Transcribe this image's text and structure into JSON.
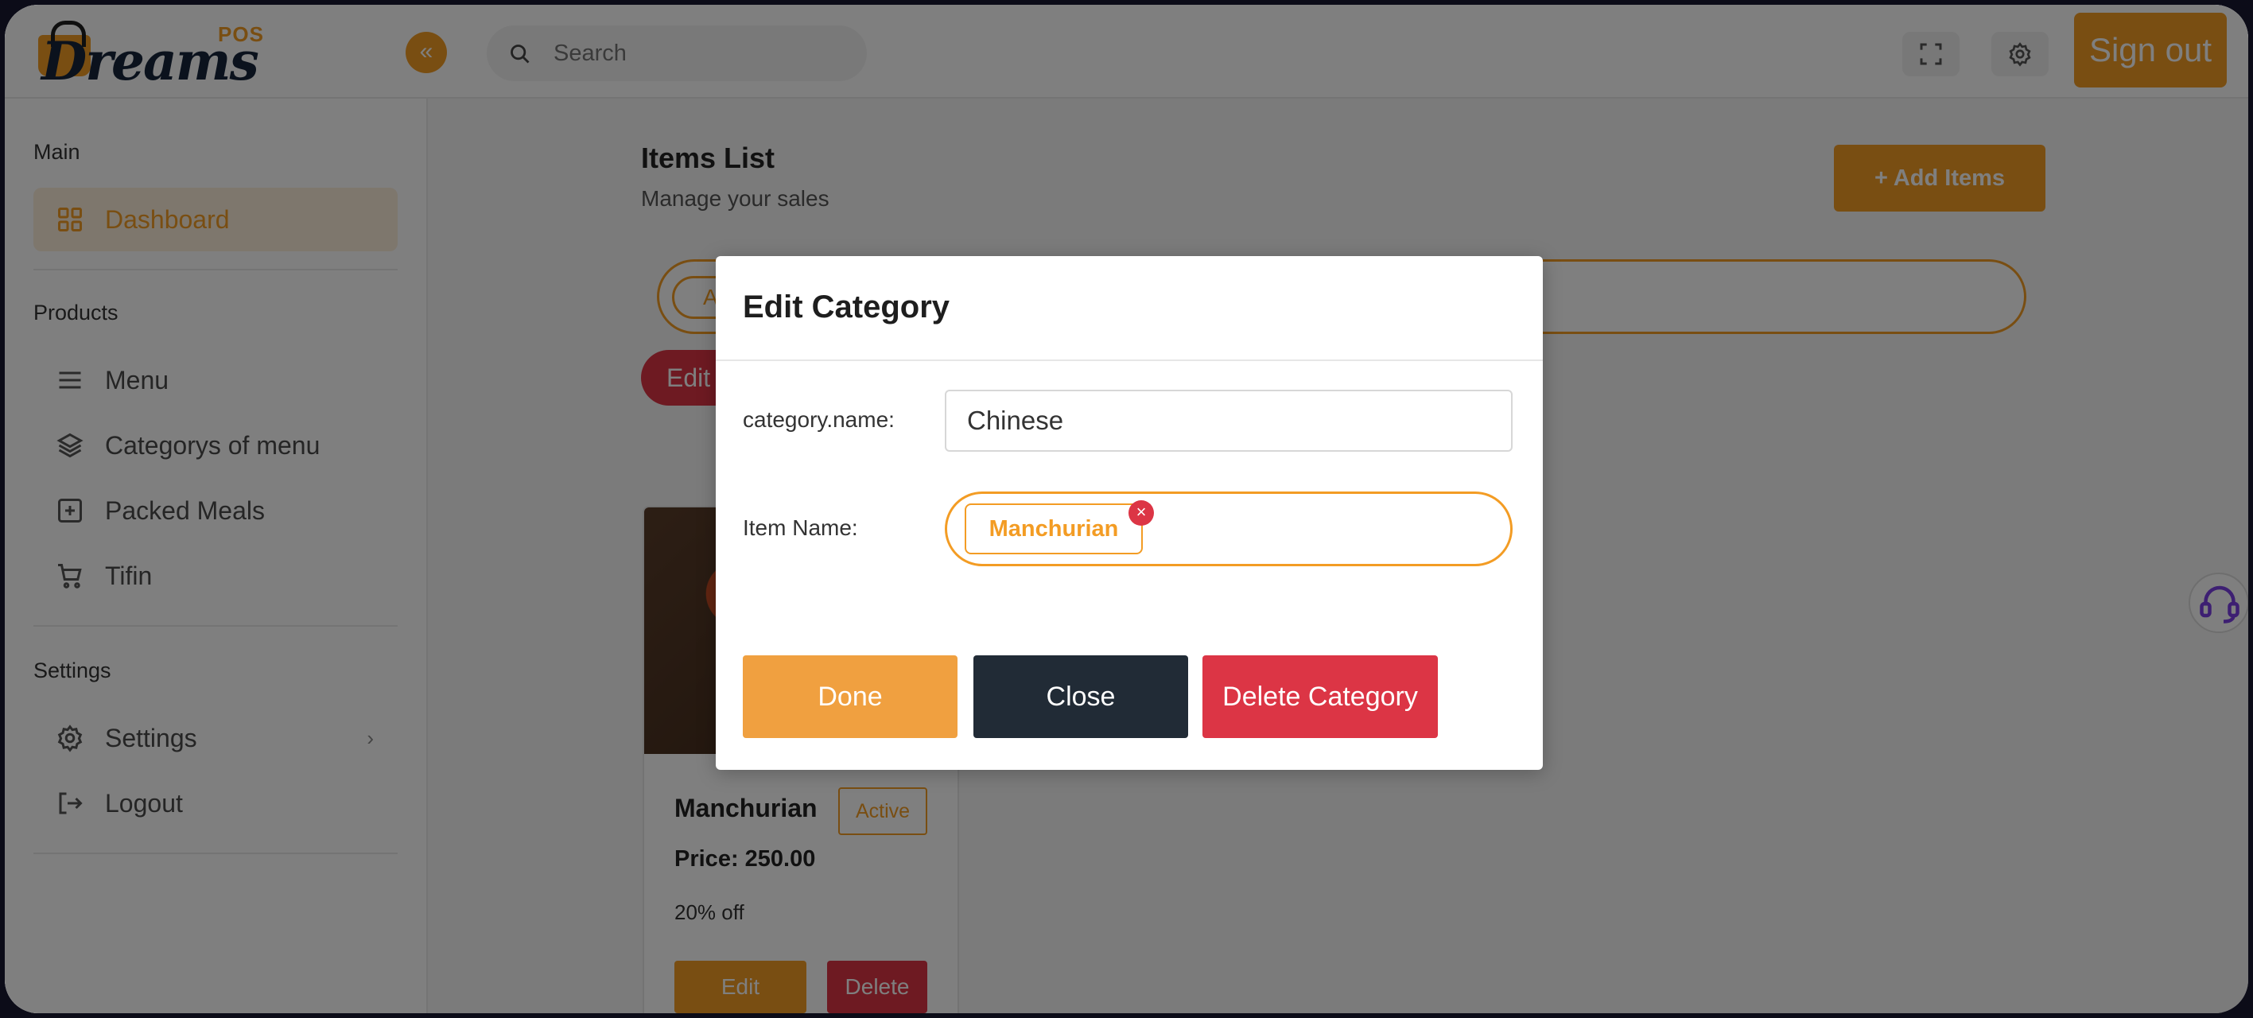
{
  "header": {
    "logo_word": "Dreams",
    "logo_badge": "POS",
    "search_placeholder": "Search",
    "sign_out_label": "Sign out"
  },
  "sidebar": {
    "sections": [
      {
        "title": "Main"
      },
      {
        "title": "Products"
      },
      {
        "title": "Settings"
      }
    ],
    "items": [
      {
        "label": "Dashboard",
        "icon": "grid-icon",
        "active": true
      },
      {
        "label": "Menu",
        "icon": "menu-lines-icon"
      },
      {
        "label": "Categorys of menu",
        "icon": "layers-icon"
      },
      {
        "label": "Packed Meals",
        "icon": "plus-square-icon"
      },
      {
        "label": "Tifin",
        "icon": "cart-icon"
      },
      {
        "label": "Settings",
        "icon": "gear-icon"
      },
      {
        "label": "Logout",
        "icon": "logout-icon"
      }
    ]
  },
  "main": {
    "title": "Items List",
    "subtitle": "Manage your sales",
    "add_items_label": "Add Items",
    "tab_partial": "A",
    "edit_chip_partial": "Edit",
    "card": {
      "name": "Manchurian",
      "status": "Active",
      "price": "Price: 250.00",
      "discount": "20% off",
      "edit_label": "Edit",
      "delete_label": "Delete"
    }
  },
  "modal": {
    "title": "Edit Category",
    "category_label": "category.name:",
    "category_value": "Chinese",
    "item_label": "Item Name:",
    "tags": [
      "Manchurian"
    ],
    "done_label": "Done",
    "close_label": "Close",
    "delete_label": "Delete Category"
  },
  "colors": {
    "accent": "#f39c24",
    "danger": "#dc3545",
    "dark": "#212b36"
  }
}
